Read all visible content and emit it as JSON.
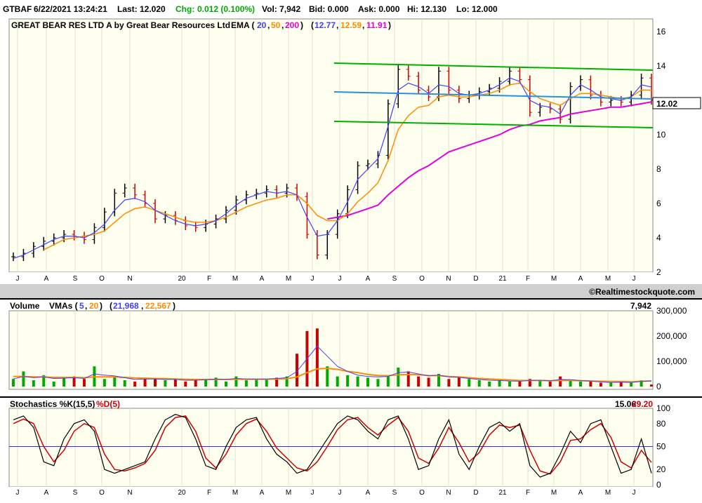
{
  "header": {
    "symbol": "GTBAF",
    "datetime": "6/22/2021 13:24:21",
    "last": "Last: 12.020",
    "chg_label": "Chg:",
    "chg_value": "0.012 (0.100%)",
    "vol": "Vol: 7,942",
    "bid": "Bid: 0.000",
    "ask": "Ask: 0.000",
    "hi": "Hi: 12.130",
    "lo": "Lo: 12.000"
  },
  "price_panel": {
    "title": "GREAT BEAR RES LTD A by Great Bear Resources Ltd",
    "ema_label": "EMA (",
    "ema_periods": [
      "20",
      "50",
      "200"
    ],
    "ema_values": [
      "12.77",
      "12.59",
      "11.91"
    ],
    "last_price_tag": "12.02",
    "watermark": "©Realtimestockquote.com"
  },
  "volume_panel": {
    "title": "Volume",
    "vma_label": "VMAs (",
    "vma_periods": [
      "5",
      "20"
    ],
    "vma_values": [
      "21,968",
      "22,567"
    ],
    "last_volume": "7,942"
  },
  "stoch_panel": {
    "title_k": "Stochastics %K(15,5)",
    "title_d": "%D(5)",
    "value_k": "15.06",
    "value_d": "29.20"
  },
  "colors": {
    "ema20": "#4040ff",
    "ema50": "#ff8c00",
    "ema200": "#e000e0",
    "green": "#00aa00",
    "red": "#cc0000",
    "trend": "#2d8fd6",
    "channel": "#00b000",
    "chg": "#00aa00"
  },
  "chart_data": [
    {
      "type": "line",
      "name": "price",
      "x_ticks": [
        "J",
        "A",
        "S",
        "O",
        "N",
        "20",
        "F",
        "M",
        "A",
        "M",
        "J",
        "J",
        "A",
        "S",
        "O",
        "N",
        "D",
        "21",
        "F",
        "M",
        "A",
        "M",
        "J"
      ],
      "ylim": [
        2,
        16
      ],
      "y_ticks": [
        2,
        4,
        6,
        8,
        10,
        12,
        14,
        16
      ],
      "close": [
        2.9,
        3.1,
        3.5,
        3.8,
        4.0,
        4.2,
        4.1,
        3.9,
        4.6,
        5.5,
        6.6,
        6.9,
        6.5,
        6.0,
        5.1,
        5.3,
        5.0,
        4.7,
        4.6,
        4.8,
        5.1,
        5.6,
        6.2,
        6.5,
        6.6,
        6.8,
        6.6,
        6.9,
        6.4,
        4.2,
        3.0,
        4.2,
        5.4,
        6.8,
        8.2,
        8.3,
        8.8,
        11.8,
        13.8,
        13.4,
        12.6,
        12.2,
        13.7,
        12.6,
        12.1,
        12.3,
        12.5,
        12.7,
        13.1,
        13.7,
        13.2,
        11.3,
        11.6,
        11.5,
        10.9,
        12.8,
        13.2,
        12.3,
        11.9,
        12.0,
        11.9,
        12.3,
        13.3,
        12.0
      ],
      "ema20": [
        2.8,
        3.0,
        3.3,
        3.6,
        3.9,
        4.1,
        4.1,
        4.0,
        4.3,
        4.8,
        5.6,
        6.2,
        6.3,
        6.1,
        5.6,
        5.3,
        5.0,
        4.8,
        4.7,
        4.8,
        5.0,
        5.4,
        5.9,
        6.3,
        6.5,
        6.7,
        6.6,
        6.7,
        6.5,
        5.2,
        4.1,
        4.2,
        5.0,
        6.1,
        7.4,
        8.0,
        8.6,
        10.5,
        12.6,
        13.0,
        12.8,
        12.4,
        12.9,
        12.8,
        12.4,
        12.3,
        12.4,
        12.6,
        12.9,
        13.3,
        13.1,
        12.0,
        11.7,
        11.6,
        11.2,
        12.3,
        12.9,
        12.6,
        12.2,
        12.1,
        12.0,
        12.2,
        12.9,
        12.77
      ],
      "ema50": [
        null,
        null,
        null,
        3.3,
        3.6,
        3.9,
        4.0,
        4.1,
        4.2,
        4.4,
        4.9,
        5.4,
        5.7,
        5.8,
        5.6,
        5.4,
        5.2,
        5.0,
        4.9,
        4.9,
        5.0,
        5.2,
        5.5,
        5.8,
        6.0,
        6.2,
        6.3,
        6.5,
        6.5,
        6.0,
        5.3,
        5.0,
        5.0,
        5.4,
        6.1,
        6.6,
        7.2,
        8.5,
        10.3,
        11.1,
        11.6,
        11.7,
        12.2,
        12.3,
        12.2,
        12.2,
        12.3,
        12.4,
        12.6,
        12.9,
        13.0,
        12.5,
        12.1,
        11.9,
        11.7,
        12.1,
        12.4,
        12.4,
        12.3,
        12.2,
        12.1,
        12.2,
        12.6,
        12.59
      ],
      "ema200": [
        null,
        null,
        null,
        null,
        null,
        null,
        null,
        null,
        null,
        null,
        null,
        null,
        null,
        null,
        null,
        null,
        null,
        null,
        null,
        null,
        null,
        null,
        null,
        null,
        null,
        null,
        null,
        null,
        null,
        null,
        null,
        5.1,
        5.2,
        5.3,
        5.5,
        5.7,
        5.9,
        6.5,
        7.0,
        7.5,
        7.9,
        8.2,
        8.6,
        9.0,
        9.2,
        9.4,
        9.6,
        9.8,
        10.0,
        10.3,
        10.5,
        10.6,
        10.8,
        10.9,
        11.0,
        11.2,
        11.3,
        11.4,
        11.5,
        11.6,
        11.6,
        11.7,
        11.8,
        11.91
      ]
    },
    {
      "type": "bar",
      "name": "volume",
      "ylim": [
        0,
        300000
      ],
      "y_ticks": [
        0,
        100000,
        200000,
        300000
      ],
      "values": [
        30000,
        60000,
        25000,
        45000,
        20000,
        35000,
        40000,
        30000,
        80000,
        30000,
        40000,
        25000,
        20000,
        35000,
        30000,
        25000,
        30000,
        20000,
        25000,
        30000,
        35000,
        20000,
        40000,
        25000,
        30000,
        28000,
        35000,
        40000,
        130000,
        220000,
        230000,
        80000,
        40000,
        45000,
        40000,
        35000,
        30000,
        45000,
        75000,
        60000,
        40000,
        35000,
        50000,
        30000,
        35000,
        30000,
        25000,
        20000,
        25000,
        20000,
        20000,
        30000,
        25000,
        20000,
        40000,
        25000,
        20000,
        20000,
        15000,
        15000,
        20000,
        15000,
        25000,
        7942
      ],
      "vma5": [
        30000,
        40000,
        35000,
        38000,
        32000,
        33000,
        35000,
        32000,
        50000,
        45000,
        42000,
        35000,
        28000,
        30000,
        30000,
        28000,
        28000,
        25000,
        25000,
        27000,
        30000,
        28000,
        32000,
        30000,
        30000,
        30000,
        32000,
        35000,
        60000,
        110000,
        160000,
        120000,
        80000,
        60000,
        45000,
        40000,
        38000,
        40000,
        55000,
        58000,
        50000,
        42000,
        45000,
        38000,
        36000,
        32000,
        28000,
        25000,
        24000,
        22000,
        21000,
        24000,
        25000,
        23000,
        28000,
        27000,
        24000,
        22000,
        18000,
        16000,
        17000,
        16000,
        20000,
        21968
      ],
      "vma20": [
        40000,
        40000,
        38000,
        38000,
        36000,
        36000,
        36000,
        35000,
        38000,
        38000,
        38000,
        36000,
        34000,
        33000,
        32000,
        31000,
        30000,
        29000,
        28000,
        28000,
        28000,
        28000,
        29000,
        29000,
        29000,
        29000,
        30000,
        31000,
        38000,
        55000,
        70000,
        72000,
        68000,
        60000,
        55000,
        48000,
        44000,
        43000,
        46000,
        48000,
        47000,
        44000,
        43000,
        40000,
        38000,
        35000,
        32000,
        30000,
        28000,
        26000,
        24000,
        24000,
        24000,
        23000,
        24000,
        24000,
        23000,
        22000,
        21000,
        20000,
        20000,
        19000,
        21000,
        22567
      ]
    },
    {
      "type": "line",
      "name": "stochastics",
      "ylim": [
        0,
        100
      ],
      "y_ticks": [
        0,
        20,
        50,
        80,
        100
      ],
      "reference_line": 50,
      "k": [
        85,
        90,
        75,
        30,
        25,
        60,
        80,
        85,
        70,
        20,
        15,
        20,
        25,
        30,
        60,
        85,
        92,
        88,
        60,
        25,
        20,
        50,
        75,
        85,
        88,
        60,
        40,
        30,
        15,
        20,
        40,
        60,
        80,
        90,
        85,
        70,
        60,
        85,
        90,
        60,
        20,
        25,
        60,
        85,
        40,
        20,
        50,
        75,
        82,
        70,
        80,
        25,
        10,
        15,
        40,
        70,
        55,
        80,
        85,
        50,
        15,
        20,
        60,
        15
      ],
      "d": [
        80,
        86,
        80,
        50,
        30,
        45,
        70,
        80,
        75,
        40,
        20,
        18,
        22,
        28,
        45,
        75,
        88,
        90,
        70,
        35,
        22,
        40,
        65,
        80,
        86,
        70,
        48,
        35,
        22,
        18,
        30,
        50,
        72,
        85,
        88,
        75,
        65,
        78,
        88,
        70,
        35,
        28,
        48,
        75,
        55,
        30,
        42,
        65,
        78,
        75,
        78,
        45,
        18,
        14,
        30,
        58,
        60,
        72,
        80,
        62,
        30,
        22,
        45,
        29.2
      ]
    }
  ]
}
